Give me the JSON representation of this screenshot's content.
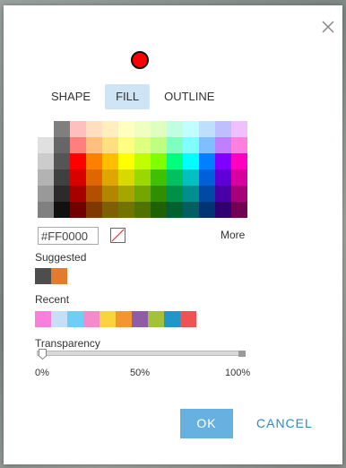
{
  "tabs": [
    {
      "label": "SHAPE"
    },
    {
      "label": "FILL"
    },
    {
      "label": "OUTLINE"
    }
  ],
  "active_tab": "FILL",
  "preview_color": "#FF0000",
  "hex_value": "#FF0000",
  "more_label": "More",
  "suggested": {
    "label": "Suggested",
    "colors": [
      "#4d4d4d",
      "#e37a2c"
    ]
  },
  "recent": {
    "label": "Recent",
    "colors": [
      "#f97fdc",
      "#c6dff7",
      "#6ecef5",
      "#f48ccb",
      "#fbd43d",
      "#f4962f",
      "#8e5da5",
      "#a4c239",
      "#2196c9",
      "#f05253"
    ]
  },
  "transparency": {
    "label": "Transparency",
    "value_percent": 0,
    "ticks": [
      "0%",
      "50%",
      "100%"
    ]
  },
  "buttons": {
    "ok": "OK",
    "cancel": "CANCEL"
  },
  "palette_rows": [
    [
      "#ffffff",
      "#7f7f7f",
      "#ffbfbf",
      "#ffdfbf",
      "#ffefbf",
      "#ffffbf",
      "#efffbf",
      "#dfffbf",
      "#bfffdf",
      "#bfffff",
      "#bfdfff",
      "#bfbfff",
      "#efbfff"
    ],
    [
      "#e0e0e0",
      "#666666",
      "#ff7f7f",
      "#ffbf7f",
      "#ffdf7f",
      "#ffff7f",
      "#dfff7f",
      "#bfff7f",
      "#7fffbf",
      "#7fffff",
      "#7fbfff",
      "#bf7fff",
      "#ff7fdf"
    ],
    [
      "#cccccc",
      "#555555",
      "#ff0000",
      "#ff7f00",
      "#ffbf00",
      "#ffff00",
      "#bfff00",
      "#7fff00",
      "#00ff7f",
      "#00ffff",
      "#007fff",
      "#7f00ff",
      "#ff00bf"
    ],
    [
      "#b3b3b3",
      "#404040",
      "#d90000",
      "#e06600",
      "#e0a600",
      "#d9d900",
      "#99d900",
      "#40c000",
      "#00c060",
      "#00c0c0",
      "#0060d9",
      "#6000d9",
      "#d900a0"
    ],
    [
      "#999999",
      "#2b2b2b",
      "#a60000",
      "#b35000",
      "#b38600",
      "#a6a600",
      "#73a600",
      "#2f8f00",
      "#009048",
      "#008f8f",
      "#004aa6",
      "#4800a6",
      "#a6007a"
    ],
    [
      "#808080",
      "#111111",
      "#730000",
      "#7f3900",
      "#7f6000",
      "#737300",
      "#507300",
      "#1f6000",
      "#006030",
      "#006060",
      "#003373",
      "#300073",
      "#730055"
    ]
  ]
}
